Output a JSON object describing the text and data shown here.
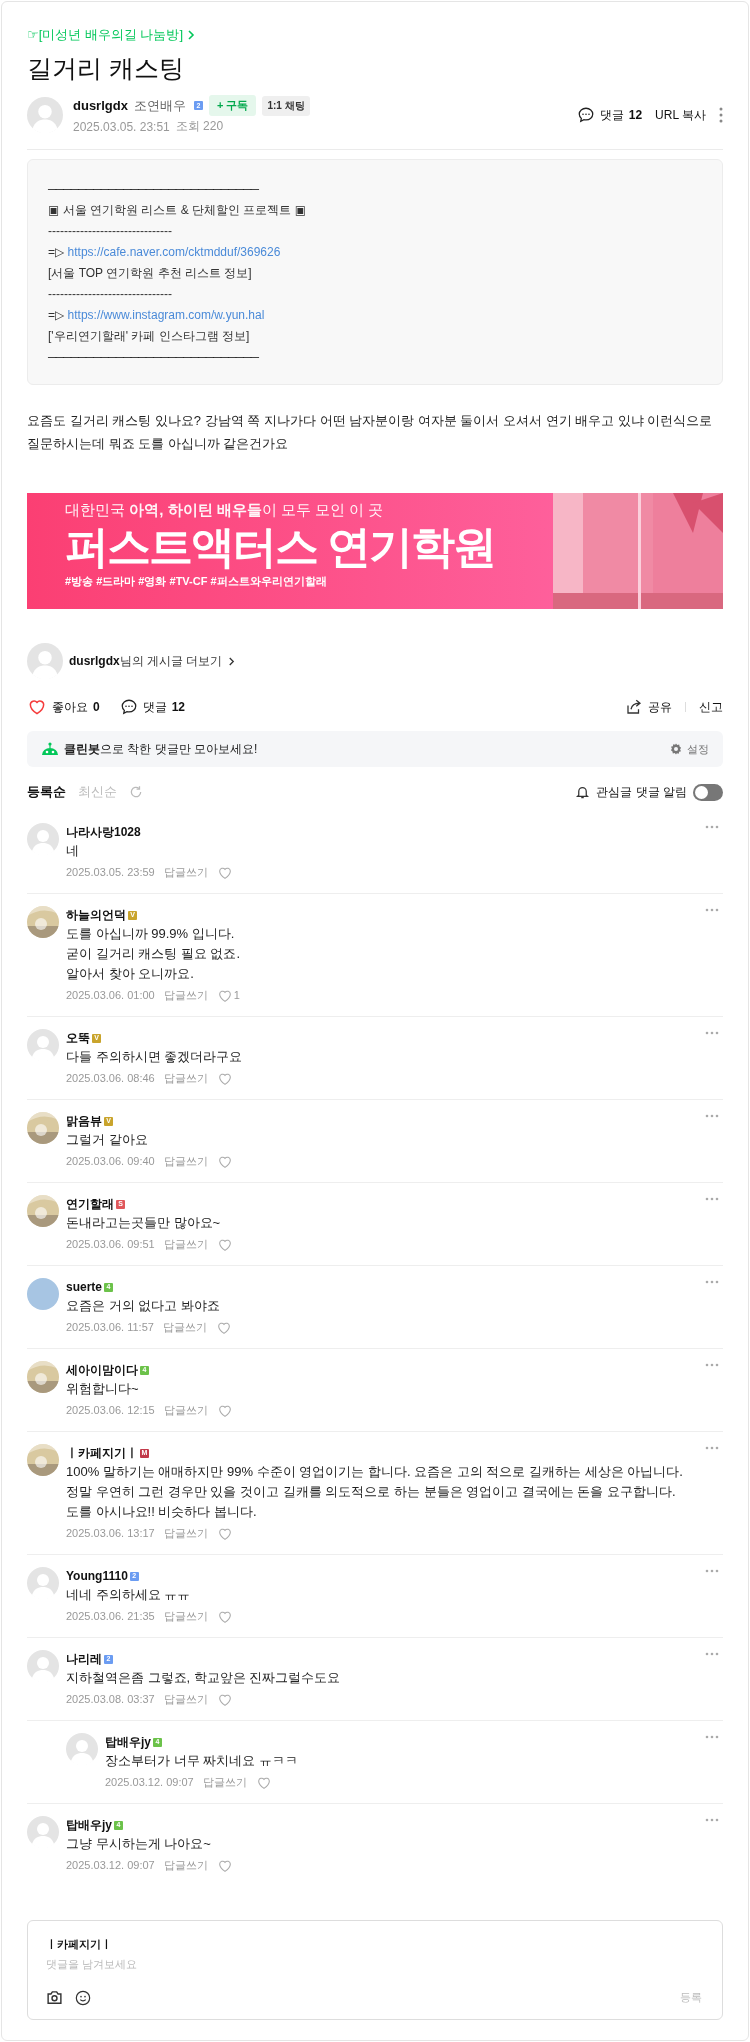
{
  "breadcrumb": "☞[미성년 배우의길 나눔방]",
  "title": "길거리 캐스팅",
  "author": {
    "name": "dusrlgdx",
    "rank": "조연배우",
    "badge": {
      "text": "2",
      "color": "#6b9cf2"
    },
    "subscribe": "+ 구독",
    "chat": "1:1 채팅",
    "date": "2025.03.05. 23:51",
    "views": "조회 220"
  },
  "header_actions": {
    "comments_label": "댓글",
    "comments_count": "12",
    "url_copy": "URL 복사"
  },
  "notice_box": [
    {
      "kind": "rule",
      "text": "────────────────────────────"
    },
    {
      "kind": "text",
      "text": "▣ 서울 연기학원 리스트 & 단체할인 프로젝트 ▣"
    },
    {
      "kind": "text",
      "text": "-------------------------------"
    },
    {
      "kind": "link",
      "prefix": "=▷",
      "text": "https://cafe.naver.com/cktmdduf/369626"
    },
    {
      "kind": "text",
      "text": "[서울 TOP 연기학원 추천 리스트 정보]"
    },
    {
      "kind": "text",
      "text": "-------------------------------"
    },
    {
      "kind": "link",
      "prefix": "=▷",
      "text": "https://www.instagram.com/w.yun.hal"
    },
    {
      "kind": "text",
      "text": "['우리연기할래' 카페 인스타그램 정보]"
    },
    {
      "kind": "rule",
      "text": "────────────────────────────"
    }
  ],
  "body": "요즘도 길거리 캐스팅 있나요? 강남역 쪽 지나가다 어떤 남자분이랑 여자분 둘이서 오셔서 연기 배우고 있냐 이런식으로 질문하시는데 뭐죠 도를 아십니까 같은건가요",
  "banner": {
    "tagline": "대한민국 **아역, 하이틴 배우들**이 모두 모인 이 곳",
    "headline": "퍼스트액터스 연기학원",
    "hashtags": "#방송 #드라마 #영화 #TV-CF #퍼스트와우리연기할래"
  },
  "author_more": {
    "name": "dusrlgdx",
    "suffix": "님의 게시글 더보기"
  },
  "reactions": {
    "like_label": "좋아요",
    "like_count": "0",
    "liked": false,
    "comment_label": "댓글",
    "comment_count": "12",
    "share": "공유",
    "report": "신고"
  },
  "cleanbot": {
    "text": "**클린봇**으로 착한 댓글만 모아보세요!",
    "settings": "설정"
  },
  "sort_tabs": [
    {
      "label": "등록순",
      "selected": true
    },
    {
      "label": "최신순",
      "selected": false
    }
  ],
  "alert_toggle": {
    "label": "관심글 댓글 알림",
    "on": false
  },
  "comments": [
    {
      "name": "나라사랑1028",
      "avatar": {
        "kind": "default"
      },
      "text": "네",
      "date": "2025.03.05. 23:59",
      "reply": "답글쓰기"
    },
    {
      "name": "하늘의언덕",
      "badge": {
        "text": "V",
        "color": "#c9a42c"
      },
      "text": "도를 아십니까 99.9% 입니다.\n굳이 길거리 캐스팅 필요 없죠.\n알아서 찾아 오니까요.",
      "date": "2025.03.06. 01:00",
      "reply": "답글쓰기",
      "likes": "1"
    },
    {
      "name": "오뚝",
      "badge": {
        "text": "V",
        "color": "#c9a42c"
      },
      "avatar": {
        "kind": "default"
      },
      "text": "다들 주의하시면 좋겠더라구요",
      "date": "2025.03.06. 08:46",
      "reply": "답글쓰기"
    },
    {
      "name": "맑음뷰",
      "badge": {
        "text": "V",
        "color": "#c9a42c"
      },
      "text": "그럴거 같아요",
      "date": "2025.03.06. 09:40",
      "reply": "답글쓰기"
    },
    {
      "name": "연기할래",
      "badge": {
        "text": "S",
        "color": "#e0575b"
      },
      "text": "돈내라고는곳들만 많아요~",
      "date": "2025.03.06. 09:51",
      "reply": "답글쓰기"
    },
    {
      "name": "suerte",
      "badge": {
        "text": "4",
        "color": "#6cc24a"
      },
      "avatar": {
        "kind": "plain",
        "color": "#a7c5e3"
      },
      "text": "요즘은 거의 없다고 봐야죠",
      "date": "2025.03.06. 11:57",
      "reply": "답글쓰기"
    },
    {
      "name": "세아이맘이다",
      "badge": {
        "text": "4",
        "color": "#6cc24a"
      },
      "text": "위험합니다~",
      "date": "2025.03.06. 12:15",
      "reply": "답글쓰기"
    },
    {
      "name": "ㅣ카페지기ㅣ",
      "badge": {
        "text": "M",
        "color": "#c23a4a"
      },
      "text": "100% 말하기는 애매하지만 99% 수준이 영업이기는 합니다. 요즘은 고의 적으로 길캐하는 세상은 아닙니다.\n정말 우연히 그런 경우만 있을 것이고 길캐를 의도적으로 하는 분들은 영업이고 결국에는 돈을 요구합니다.\n도를 아시나요!! 비슷하다 봅니다.",
      "date": "2025.03.06. 13:17",
      "reply": "답글쓰기"
    },
    {
      "name": "Young1110",
      "badge": {
        "text": "2",
        "color": "#6b9cf2"
      },
      "avatar": {
        "kind": "default"
      },
      "text": "네네 주의하세요 ㅠㅠ",
      "date": "2025.03.06. 21:35",
      "reply": "답글쓰기"
    },
    {
      "name": "나리레",
      "badge": {
        "text": "2",
        "color": "#6b9cf2"
      },
      "avatar": {
        "kind": "default"
      },
      "text": "지하철역은좀 그렇죠, 학교앞은 진짜그럴수도요",
      "date": "2025.03.08. 03:37",
      "reply": "답글쓰기",
      "children": [
        {
          "name": "탑배우jy",
          "badge": {
            "text": "4",
            "color": "#6cc24a"
          },
          "avatar": {
            "kind": "default"
          },
          "text": "장소부터가 너무 짜치네요 ㅠㅋㅋ",
          "date": "2025.03.12. 09:07",
          "reply": "답글쓰기"
        }
      ]
    },
    {
      "name": "탑배우jy",
      "badge": {
        "text": "4",
        "color": "#6cc24a"
      },
      "avatar": {
        "kind": "default"
      },
      "text": "그냥 무시하는게 나아요~",
      "date": "2025.03.12. 09:07",
      "reply": "답글쓰기"
    }
  ],
  "composer": {
    "name": "ㅣ카페지기ㅣ",
    "placeholder": "댓글을 남겨보세요",
    "submit": "등록"
  }
}
